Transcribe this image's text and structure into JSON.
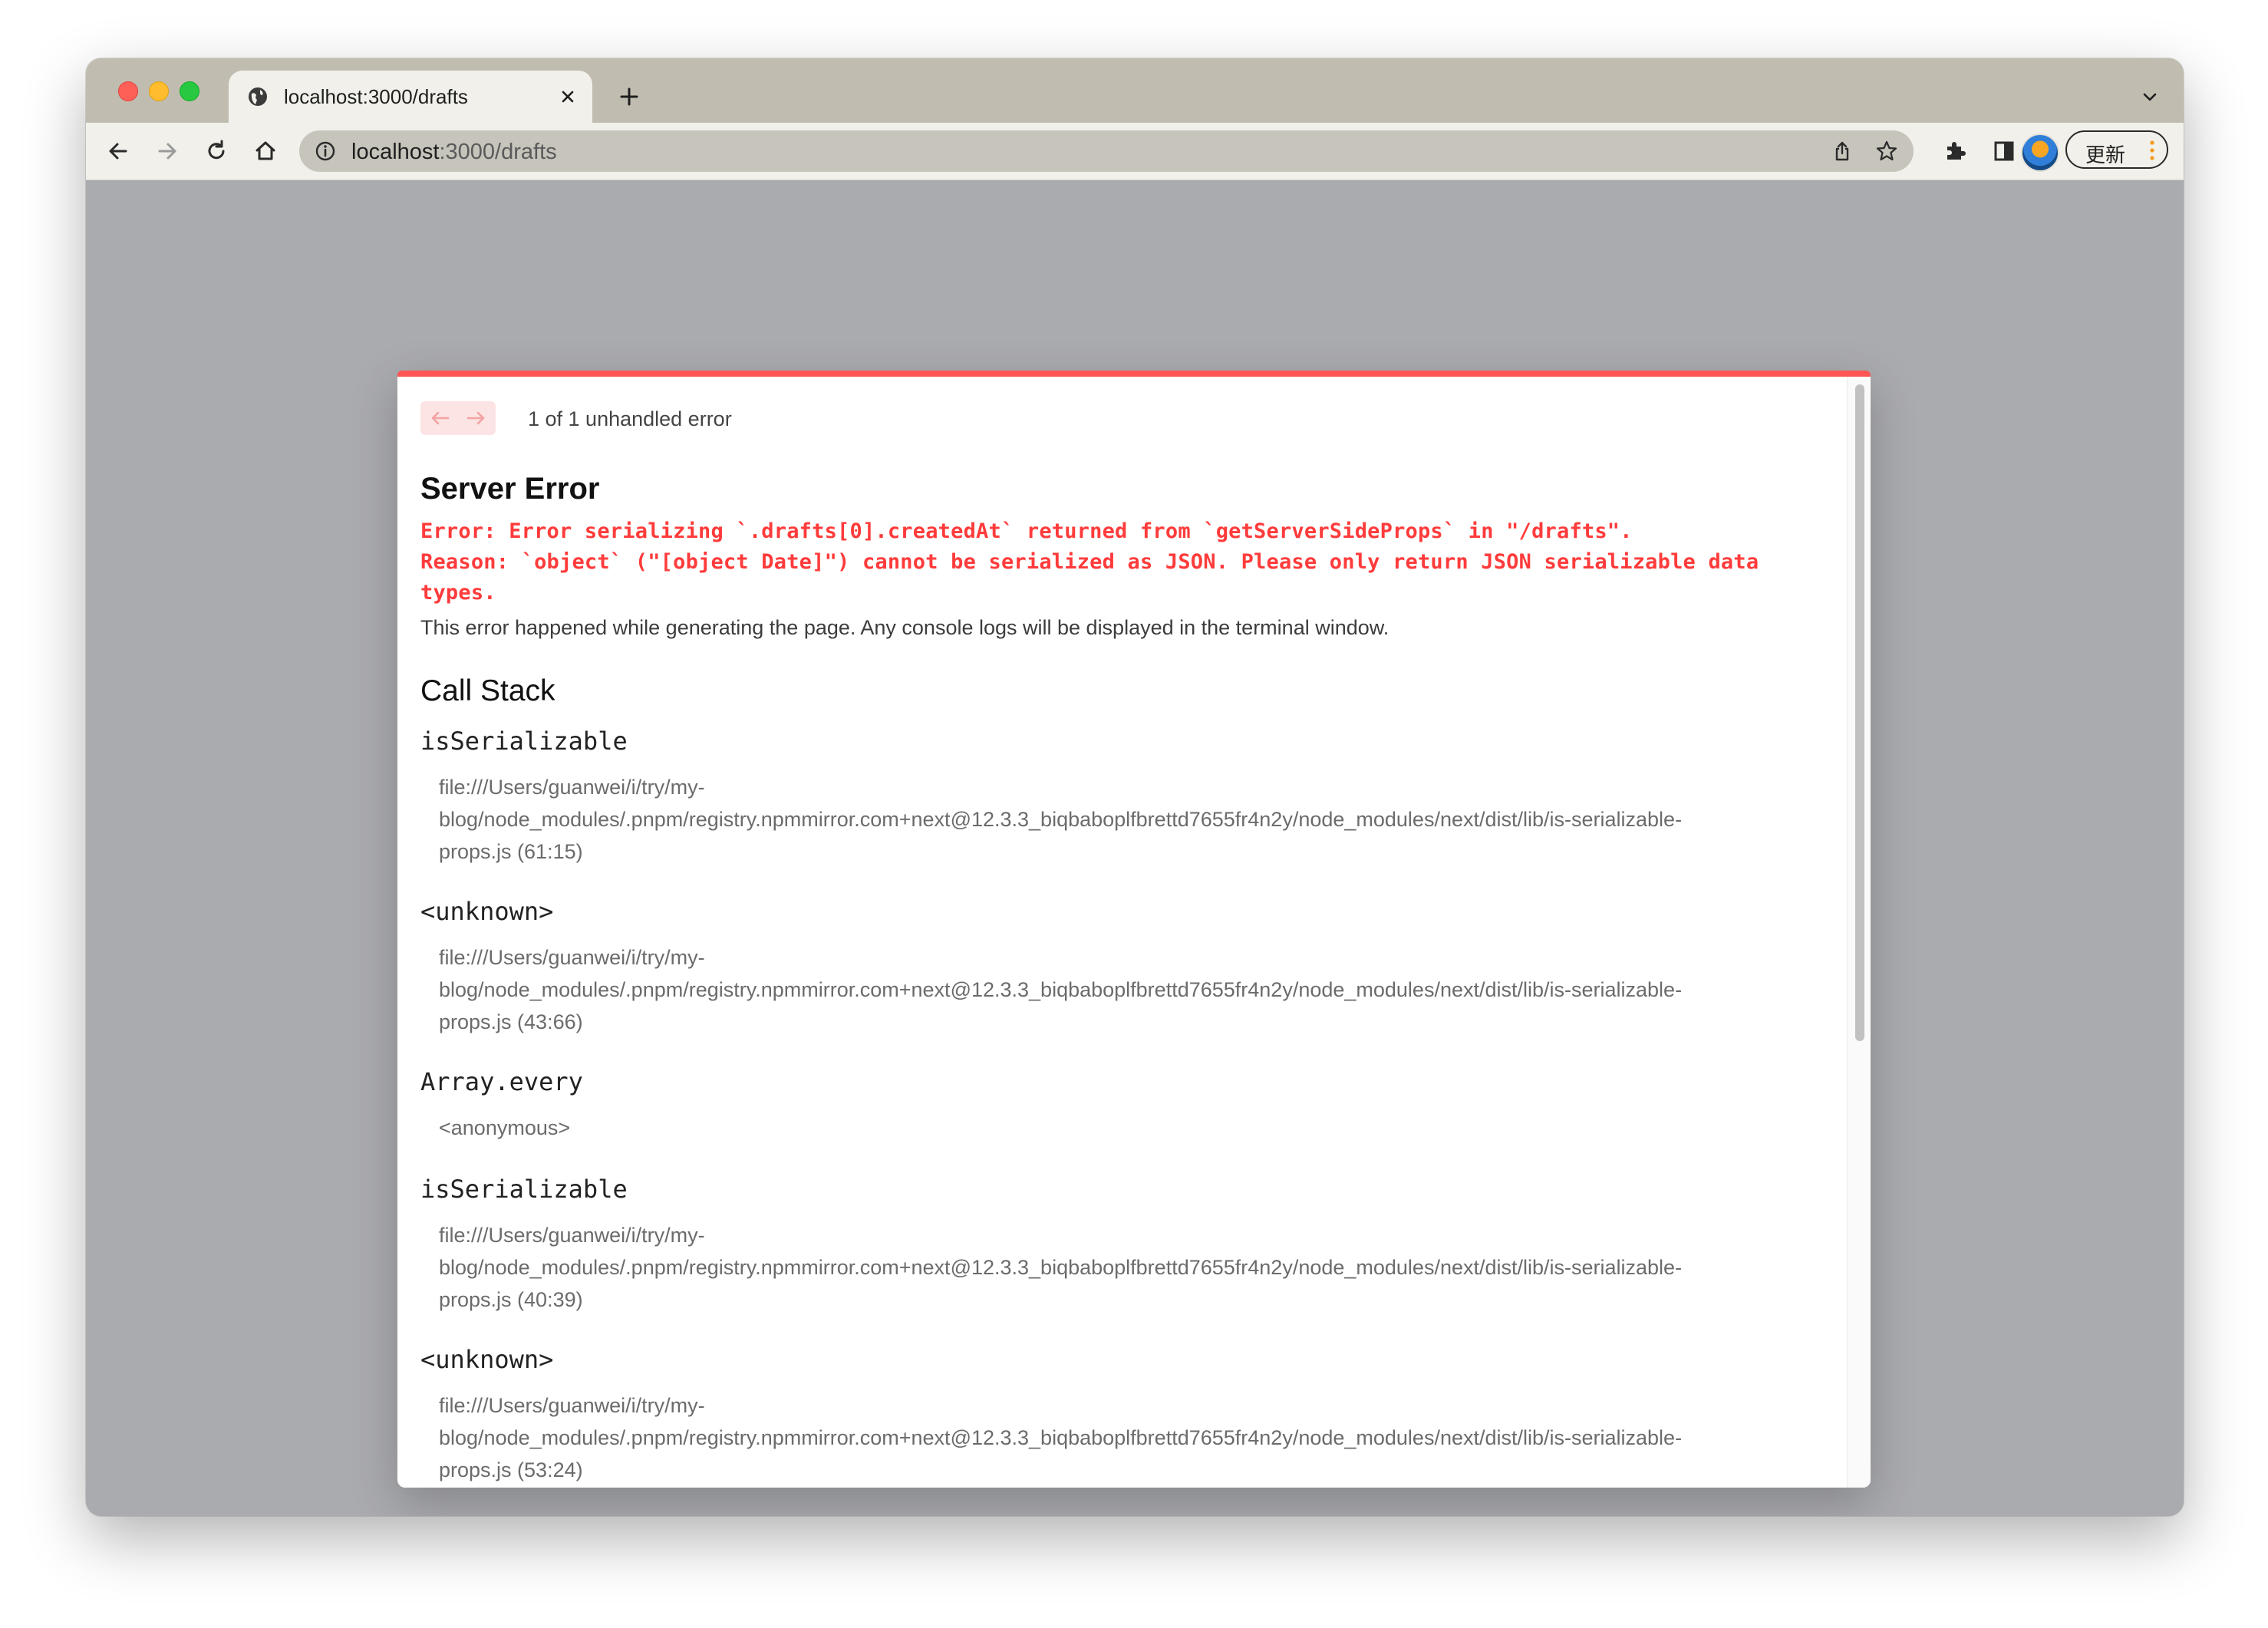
{
  "browser": {
    "tab_title": "localhost:3000/drafts",
    "url_host": "localhost",
    "url_path": ":3000/drafts",
    "update_label": "更新"
  },
  "overlay": {
    "error_count": "1 of 1 unhandled error",
    "title": "Server Error",
    "error_line_1": "Error: Error serializing `.drafts[0].createdAt` returned from `getServerSideProps` in \"/drafts\".",
    "error_line_2": "Reason: `object` (\"[object Date]\") cannot be serialized as JSON. Please only return JSON serializable data",
    "error_line_3": "types.",
    "description": "This error happened while generating the page. Any console logs will be displayed in the terminal window.",
    "call_stack_title": "Call Stack",
    "frames": [
      {
        "name": "isSerializable",
        "file_1": "file:///Users/guanwei/i/try/my-",
        "file_2": "blog/node_modules/.pnpm/registry.npmmirror.com+next@12.3.3_biqbaboplfbrettd7655fr4n2y/node_modules/next/dist/lib/is-serializable-",
        "file_3": "props.js (61:15)"
      },
      {
        "name": "<unknown>",
        "file_1": "file:///Users/guanwei/i/try/my-",
        "file_2": "blog/node_modules/.pnpm/registry.npmmirror.com+next@12.3.3_biqbaboplfbrettd7655fr4n2y/node_modules/next/dist/lib/is-serializable-",
        "file_3": "props.js (43:66)"
      },
      {
        "name": "Array.every",
        "file_1": "<anonymous>"
      },
      {
        "name": "isSerializable",
        "file_1": "file:///Users/guanwei/i/try/my-",
        "file_2": "blog/node_modules/.pnpm/registry.npmmirror.com+next@12.3.3_biqbaboplfbrettd7655fr4n2y/node_modules/next/dist/lib/is-serializable-",
        "file_3": "props.js (40:39)"
      },
      {
        "name": "<unknown>",
        "file_1": "file:///Users/guanwei/i/try/my-",
        "file_2": "blog/node_modules/.pnpm/registry.npmmirror.com+next@12.3.3_biqbaboplfbrettd7655fr4n2y/node_modules/next/dist/lib/is-serializable-",
        "file_3": "props.js (53:24)"
      }
    ]
  },
  "colors": {
    "accent": "#ff5555",
    "error_text": "#ff3b3b",
    "pager_bg": "#fde4e4",
    "page_backdrop": "#aaabaf"
  },
  "icons": [
    "globe-icon",
    "close-icon",
    "plus-icon",
    "chevron-down-icon",
    "back-arrow-icon",
    "forward-arrow-icon",
    "reload-icon",
    "home-icon",
    "info-icon",
    "share-icon",
    "star-icon",
    "puzzle-icon",
    "side-panel-icon",
    "more-vertical-icon",
    "arrow-left-icon",
    "arrow-right-icon"
  ]
}
